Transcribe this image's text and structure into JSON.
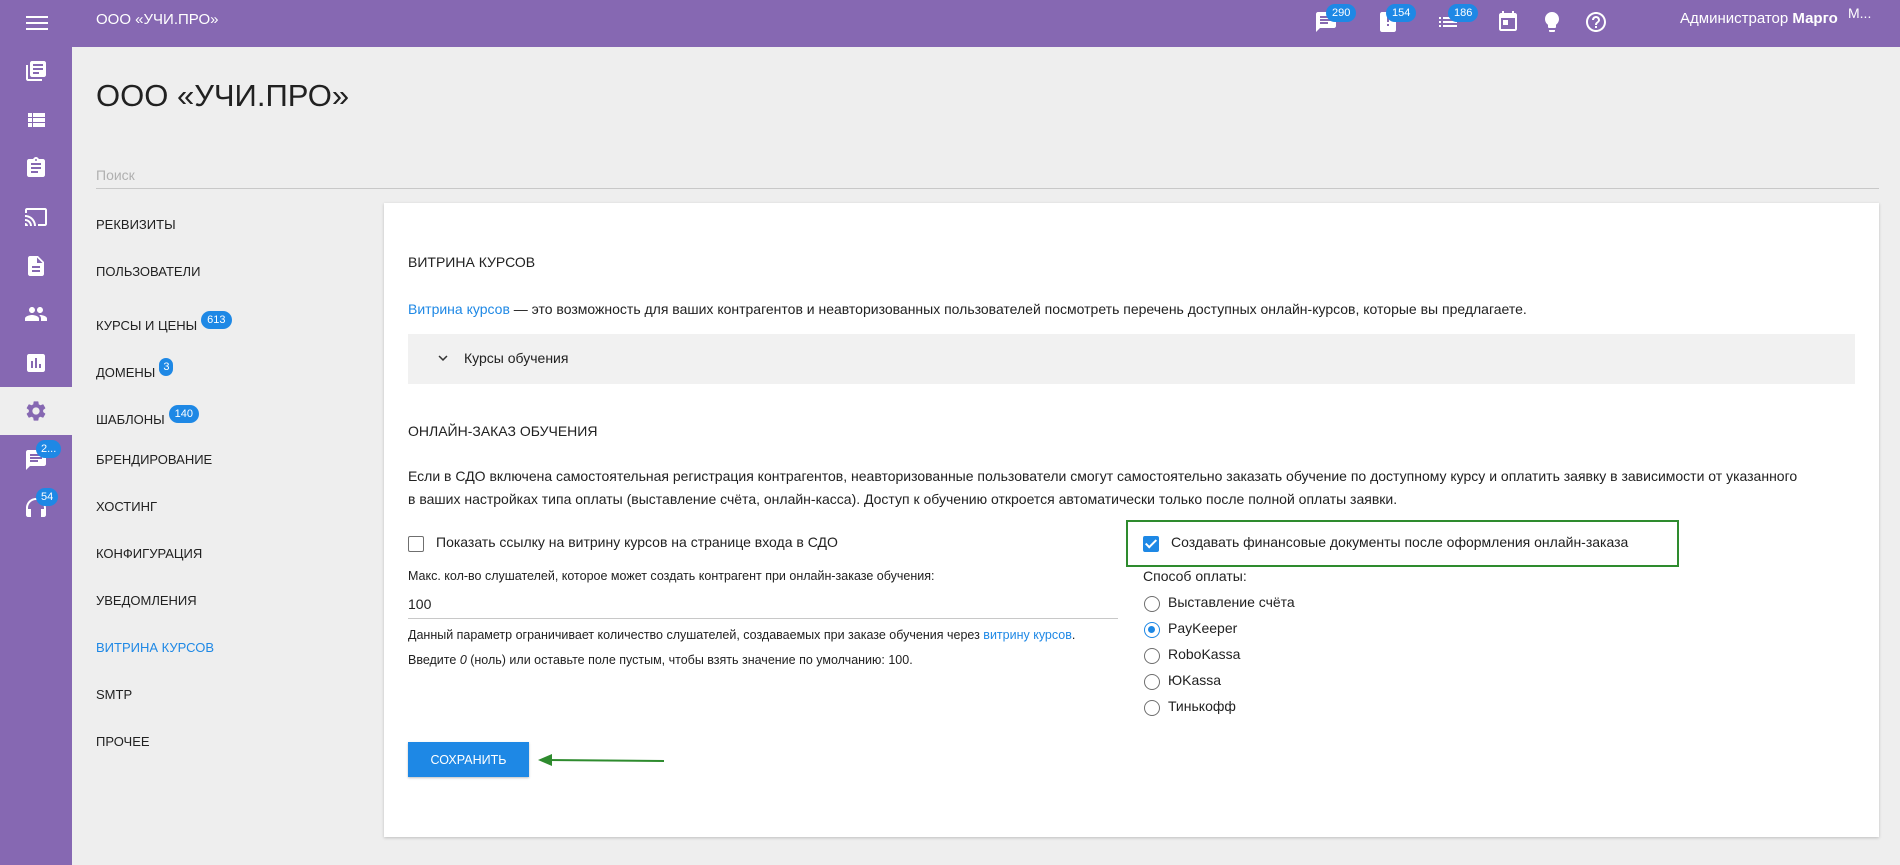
{
  "topbar": {
    "org_name": "ООО «УЧИ.ПРО»",
    "badges": {
      "messages": "290",
      "tasks": "154",
      "reports": "186"
    },
    "user_role": "Администратор",
    "user_name": "Марго",
    "avatar_alt": "M..."
  },
  "rail": {
    "chat_badge": "2...",
    "support_badge": "54"
  },
  "page": {
    "title": "ООО «УЧИ.ПРО»",
    "search_placeholder": "Поиск"
  },
  "nav": {
    "items": [
      {
        "label": "РЕКВИЗИТЫ"
      },
      {
        "label": "ПОЛЬЗОВАТЕЛИ"
      },
      {
        "label": "КУРСЫ И ЦЕНЫ",
        "badge": "613"
      },
      {
        "label": "ДОМЕНЫ",
        "badge": "3"
      },
      {
        "label": "ШАБЛОНЫ",
        "badge": "140"
      },
      {
        "label": "БРЕНДИРОВАНИЕ"
      },
      {
        "label": "ХОСТИНГ"
      },
      {
        "label": "КОНФИГУРАЦИЯ"
      },
      {
        "label": "УВЕДОМЛЕНИЯ"
      },
      {
        "label": "ВИТРИНА КУРСОВ",
        "active": true
      },
      {
        "label": "SMTP"
      },
      {
        "label": "ПРОЧЕЕ"
      }
    ]
  },
  "showcase": {
    "title": "ВИТРИНА КУРСОВ",
    "link_text": "Витрина курсов",
    "description": " — это возможность для ваших контрагентов и неавторизованных пользователей посмотреть перечень доступных онлайн-курсов, которые вы предлагаете.",
    "accordion_label": "Курсы обучения"
  },
  "online_order": {
    "title": "ОНЛАЙН-ЗАКАЗ ОБУЧЕНИЯ",
    "description_line1": "Если в СДО включена самостоятельная регистрация контрагентов, неавторизованные пользователи смогут самостоятельно заказать обучение по доступному курсу и оплатить заявку в зависимости от указанного",
    "description_line2": "в ваших настройках типа оплаты (выставление счёта, онлайн-касса). Доступ к обучению откроется автоматически только после полной оплаты заявки.",
    "show_link_label": "Показать ссылку на витрину курсов на странице входа в СДО",
    "show_link_checked": false,
    "create_docs_label": "Создавать финансовые документы после оформления онлайн-заказа",
    "create_docs_checked": true,
    "max_listeners_label": "Макс. кол-во слушателей, которое может создать контрагент при онлайн-заказе обучения:",
    "max_listeners_value": "100",
    "hint1_prefix": "Данный параметр ограничивает количество слушателей, создаваемых при заказе обучения через ",
    "hint1_link": "витрину курсов",
    "hint1_suffix": ".",
    "hint2_prefix": "Введите ",
    "hint2_zero": "0",
    "hint2_suffix": " (ноль) или оставьте поле пустым, чтобы взять значение по умолчанию: 100.",
    "payment_label": "Способ оплаты:",
    "payment_options": [
      {
        "label": "Выставление счёта",
        "checked": false
      },
      {
        "label": "PayKeeper",
        "checked": true
      },
      {
        "label": "RoboKassa",
        "checked": false
      },
      {
        "label": "ЮKassa",
        "checked": false
      },
      {
        "label": "Тинькофф",
        "checked": false
      }
    ],
    "save_label": "СОХРАНИТЬ"
  },
  "colors": {
    "brand_purple": "#8668b2",
    "accent_blue": "#1e88e5",
    "highlight_green": "#2e8b2e"
  }
}
